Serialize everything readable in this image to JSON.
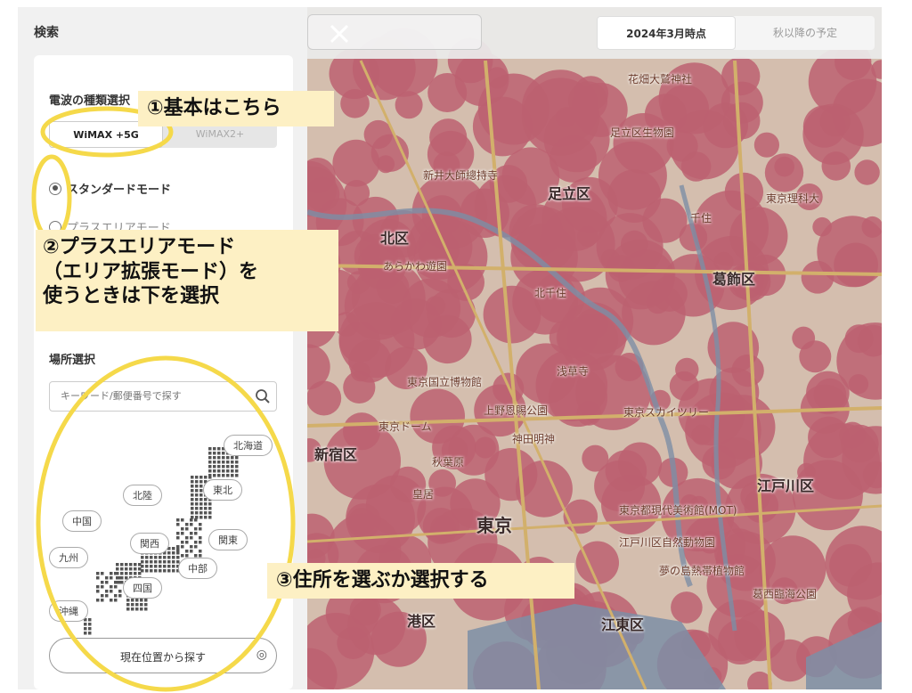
{
  "sidebar": {
    "title": "検索",
    "wave_section_title": "電波の種類選択",
    "toggle": {
      "option1": "WiMAX +5G",
      "option2": "WiMAX2+"
    },
    "modes": [
      {
        "label": "スタンダードモード",
        "selected": true
      },
      {
        "label": "プラスエリアモード",
        "selected": false
      }
    ],
    "place_section_title": "場所選択",
    "search_placeholder": "キーワード/郵便番号で探す",
    "regions": [
      "北海道",
      "東北",
      "北陸",
      "中国",
      "関西",
      "関東",
      "九州",
      "中部",
      "四国",
      "沖縄"
    ],
    "locate_button": "現在位置から探す"
  },
  "topbar": {
    "tab_now": "2024年3月時点",
    "tab_future": "秋以降の予定"
  },
  "map": {
    "labels": [
      "北区",
      "足立区",
      "葛飾区",
      "新宿区",
      "東京",
      "江戸川区",
      "港区",
      "江東区"
    ],
    "small_labels": [
      "花畑大鷲神社",
      "足立区生物園",
      "新井大師總持寺",
      "東京理科大",
      "千住",
      "北千住",
      "あらかわ遊園",
      "浅草寺",
      "東京スカイツリー",
      "上野恩賜公園",
      "東京国立博物館",
      "秋葉原",
      "皇居",
      "神田明神",
      "東京ドーム",
      "東京都現代美術館(MOT)",
      "夢の島熱帯植物館",
      "江戸川区自然動物園",
      "葛西臨海公園"
    ],
    "colors": {
      "coverage": "#d76f80",
      "base": "#f2d9c7",
      "water": "#8fa2bd",
      "road": "#f0c97a"
    }
  },
  "annotations": {
    "a1": "①基本はこちら",
    "a2_line1": "②プラスエリアモード",
    "a2_line2": "（エリア拡張モード）を",
    "a2_line3": "使うときは下を選択",
    "a3": "③住所を選ぶか選択する",
    "highlight_color": "#f5d94a"
  }
}
